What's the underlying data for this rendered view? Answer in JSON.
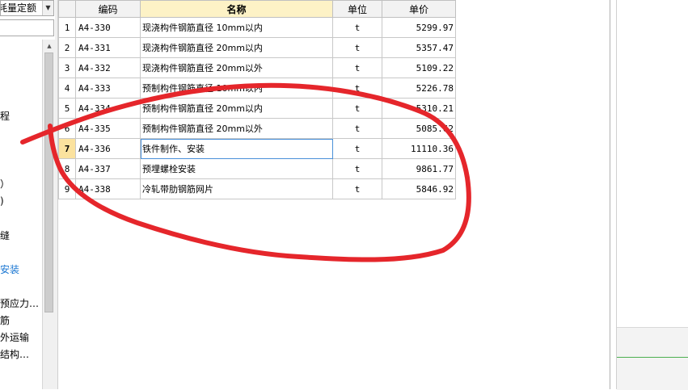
{
  "left_panel": {
    "quota_combo": {
      "value": "耗量定额",
      "arrow": "▼"
    },
    "tree_items": [
      {
        "label": "程",
        "selected": false
      },
      {
        "label": "）",
        "selected": false
      },
      {
        "label": ")",
        "selected": false
      },
      {
        "label": "缝",
        "selected": false
      },
      {
        "label": "安装",
        "selected": true
      },
      {
        "label": "预应力…",
        "selected": false
      },
      {
        "label": "筋",
        "selected": false
      },
      {
        "label": "外运输",
        "selected": false
      },
      {
        "label": "结构…",
        "selected": false
      }
    ]
  },
  "grid": {
    "columns": {
      "code": "编码",
      "name": "名称",
      "unit": "单位",
      "price": "单价"
    },
    "current_row": 7,
    "rows": [
      {
        "num": "1",
        "code": "A4-330",
        "name": "现浇构件钢筋直径 10mm以内",
        "unit": "t",
        "price": "5299.97"
      },
      {
        "num": "2",
        "code": "A4-331",
        "name": "现浇构件钢筋直径 20mm以内",
        "unit": "t",
        "price": "5357.47"
      },
      {
        "num": "3",
        "code": "A4-332",
        "name": "现浇构件钢筋直径 20mm以外",
        "unit": "t",
        "price": "5109.22"
      },
      {
        "num": "4",
        "code": "A4-333",
        "name": "预制构件钢筋直径 10mm以内",
        "unit": "t",
        "price": "5226.78"
      },
      {
        "num": "5",
        "code": "A4-334",
        "name": "预制构件钢筋直径 20mm以内",
        "unit": "t",
        "price": "5310.21"
      },
      {
        "num": "6",
        "code": "A4-335",
        "name": "预制构件钢筋直径 20mm以外",
        "unit": "t",
        "price": "5085.62"
      },
      {
        "num": "7",
        "code": "A4-336",
        "name": "铁件制作、安装",
        "unit": "t",
        "price": "11110.36"
      },
      {
        "num": "8",
        "code": "A4-337",
        "name": "预埋螺栓安装",
        "unit": "t",
        "price": "9861.77"
      },
      {
        "num": "9",
        "code": "A4-338",
        "name": "冷轧带肋钢筋网片",
        "unit": "t",
        "price": "5846.92"
      }
    ]
  },
  "colors": {
    "annotation": "#e5262b",
    "header_active": "#fdf2c6",
    "current_row_marker": "#fbe29e",
    "selected_tree_item": "#1976d2",
    "status_line": "#4caf50"
  }
}
